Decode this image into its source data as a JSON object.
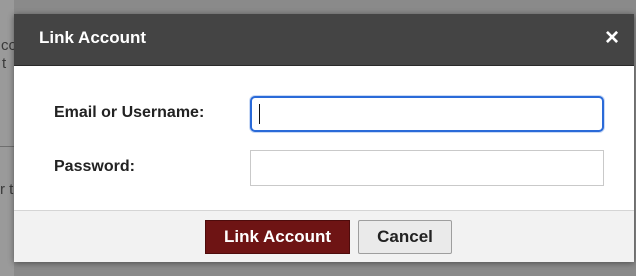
{
  "background": {
    "fragments": [
      "co",
      "t",
      "r t"
    ]
  },
  "dialog": {
    "title": "Link Account",
    "close_symbol": "×",
    "close_icon": "close-icon",
    "fields": {
      "email_label": "Email or Username:",
      "email_value": "",
      "password_label": "Password:",
      "password_value": ""
    },
    "buttons": {
      "primary_label": "Link Account",
      "secondary_label": "Cancel"
    }
  },
  "colors": {
    "titlebar": "#444444",
    "primary_button": "#6e1414",
    "focus_ring": "#2a6ad8"
  }
}
